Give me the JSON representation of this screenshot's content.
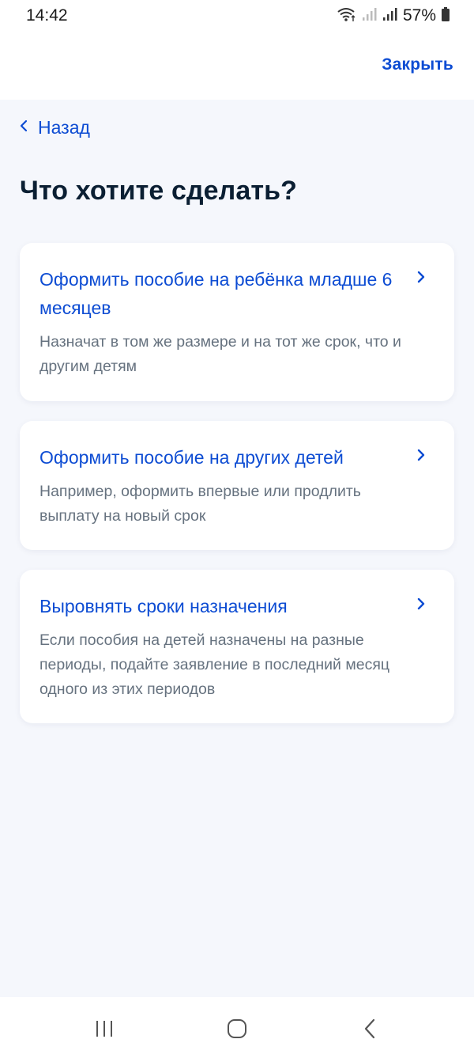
{
  "status_bar": {
    "time": "14:42",
    "battery": "57%",
    "icons": [
      "wifi-icon",
      "signal-icon",
      "signal-icon",
      "battery-icon"
    ]
  },
  "header": {
    "close_label": "Закрыть"
  },
  "navigation": {
    "back_label": "Назад"
  },
  "page": {
    "title": "Что хотите сделать?"
  },
  "options": [
    {
      "title": "Оформить пособие на ребёнка младше 6 месяцев",
      "description": "Назначат в том же размере и на тот же срок, что и другим детям"
    },
    {
      "title": "Оформить пособие на других детей",
      "description": "Например, оформить впервые или продлить выплату на новый срок"
    },
    {
      "title": "Выровнять сроки назначения",
      "description": "Если пособия на детей назначены на разные периоды, подайте заявление в последний месяц одного из этих периодов"
    }
  ],
  "system_nav": {
    "icons": [
      "recent-apps-icon",
      "home-icon",
      "back-icon"
    ]
  },
  "colors": {
    "accent": "#0d4cd3",
    "title": "#0b1f33",
    "secondary_text": "#66727f",
    "background": "#f5f7fc",
    "card": "#ffffff"
  }
}
